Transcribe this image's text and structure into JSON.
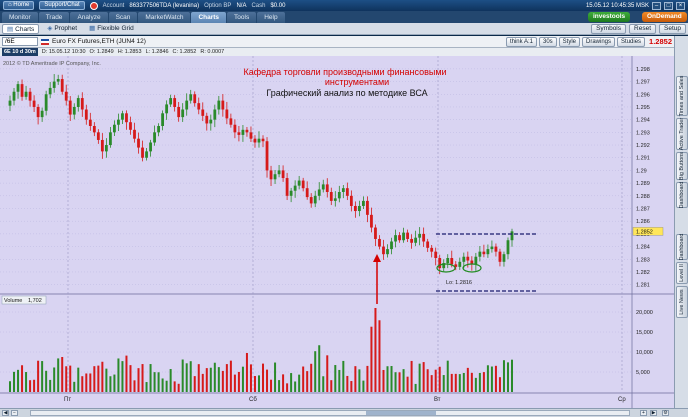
{
  "titlebar": {
    "home": "Home",
    "support": "Support/Chat",
    "account_label": "Account",
    "account_value": "863377506TDA (levanina)",
    "option_bp_label": "Option BP",
    "option_bp_value": "N/A",
    "cash_label": "Cash",
    "cash_value": "$0.00",
    "timestamp": "15.05.12 10:45:35 MSK"
  },
  "main_tabs": [
    "Monitor",
    "Trade",
    "Analyze",
    "Scan",
    "MarketWatch",
    "Charts",
    "Tools",
    "Help"
  ],
  "brand": {
    "investools": "investools",
    "ondemand": "OnDemand"
  },
  "sub_tabs": [
    "Charts",
    "Prophet",
    "Flexible Grid"
  ],
  "sub_right": [
    "Symbols",
    "Reset",
    "Setup"
  ],
  "toolbar": {
    "symbol": "/6E",
    "description": "Euro FX Futures,ETH (JUN4 12)",
    "buttons": [
      "think A:1",
      "30s",
      "Style",
      "Drawings",
      "Studies"
    ],
    "last_price": "1.2852"
  },
  "infoline": {
    "period": "6E 10 d 30m",
    "date": "D: 15.05.12 10:30",
    "open": "O: 1.2849",
    "high": "H: 1.2853",
    "low": "L: 1.2846",
    "close": "C: 1.2852",
    "range": "R: 0.0007"
  },
  "chart": {
    "copyright": "2012 © TD Ameritrade IP Company, Inc.",
    "annotation_line1": "Кафедра торговли производными финансовыми",
    "annotation_line2": "инструментами",
    "annotation_line3": "Графический анализ по методике ВСА",
    "low_label": "Lo: 1.2816",
    "price_ticks": [
      "1.298",
      "1.297",
      "1.296",
      "1.295",
      "1.294",
      "1.293",
      "1.292",
      "1.291",
      "1.29",
      "1.289",
      "1.288",
      "1.287",
      "1.286",
      "1.285",
      "1.284",
      "1.283",
      "1.282",
      "1.281"
    ],
    "volume_label": "Volume",
    "volume_value": "1,702",
    "volume_ticks": [
      "20,000",
      "15,000",
      "10,000",
      "5,000"
    ],
    "x_ticks": [
      "Пт",
      "Сб",
      "Вт",
      "Ср"
    ],
    "colors": {
      "background": "#d9d4f2",
      "up": "#2a8a2a",
      "down": "#d61a1a",
      "annotation": "#d40000",
      "line": "#1a1a6e"
    }
  },
  "chart_data": {
    "type": "candlestick",
    "ylim": [
      1.2805,
      1.2987
    ],
    "volume_ylim": [
      0,
      22000
    ],
    "close": [
      1.2955,
      1.2962,
      1.2968,
      1.2958,
      1.2962,
      1.2955,
      1.295,
      1.2942,
      1.2947,
      1.296,
      1.2965,
      1.297,
      1.2972,
      1.2962,
      1.2955,
      1.2944,
      1.295,
      1.2957,
      1.2948,
      1.294,
      1.2935,
      1.293,
      1.2924,
      1.2915,
      1.292,
      1.293,
      1.2936,
      1.294,
      1.2945,
      1.2938,
      1.2932,
      1.2925,
      1.2918,
      1.291,
      1.2915,
      1.2922,
      1.293,
      1.2935,
      1.2945,
      1.2952,
      1.2957,
      1.295,
      1.2942,
      1.2948,
      1.2955,
      1.296,
      1.2953,
      1.2948,
      1.2943,
      1.2937,
      1.294,
      1.2948,
      1.2955,
      1.2948,
      1.2941,
      1.2936,
      1.293,
      1.2928,
      1.2932,
      1.293,
      1.2925,
      1.2922,
      1.2925,
      1.2923,
      1.29,
      1.2893,
      1.2897,
      1.29,
      1.2894,
      1.288,
      1.2884,
      1.2888,
      1.2892,
      1.2886,
      1.2879,
      1.2874,
      1.288,
      1.2885,
      1.2889,
      1.2883,
      1.2876,
      1.2878,
      1.2883,
      1.2886,
      1.288,
      1.2872,
      1.2868,
      1.2872,
      1.2876,
      1.2865,
      1.2855,
      1.2846,
      1.284,
      1.2834,
      1.2838,
      1.2844,
      1.2849,
      1.2845,
      1.2851,
      1.2846,
      1.2843,
      1.2847,
      1.285,
      1.2844,
      1.2839,
      1.2836,
      1.2831,
      1.2823,
      1.2827,
      1.2831,
      1.2826,
      1.2824,
      1.2828,
      1.2832,
      1.2829,
      1.2826,
      1.2832,
      1.2836,
      1.2834,
      1.2838,
      1.284,
      1.2836,
      1.2828,
      1.2834,
      1.2845,
      1.2852
    ]
  }
}
